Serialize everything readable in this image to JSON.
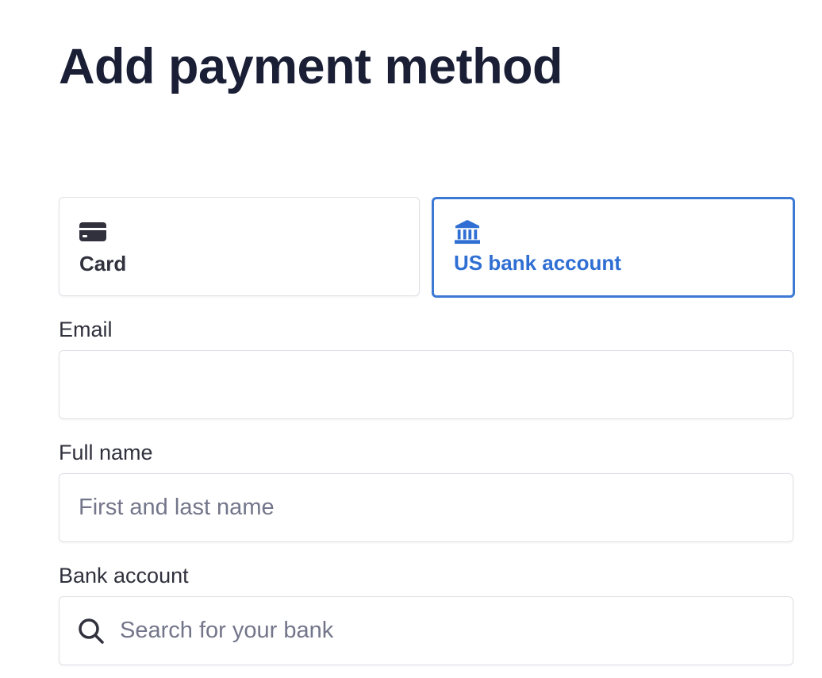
{
  "page": {
    "title": "Add payment method"
  },
  "tabs": [
    {
      "label": "Card",
      "icon": "card-icon",
      "selected": false
    },
    {
      "label": "US bank account",
      "icon": "bank-icon",
      "selected": true
    }
  ],
  "form": {
    "email": {
      "label": "Email",
      "value": "",
      "placeholder": ""
    },
    "full_name": {
      "label": "Full name",
      "value": "",
      "placeholder": "First and last name"
    },
    "bank_account": {
      "label": "Bank account",
      "value": "",
      "placeholder": "Search for your bank",
      "icon": "search-icon"
    }
  },
  "colors": {
    "title": "#1a1f36",
    "accent": "#3b79d5",
    "text": "#30313d",
    "placeholder": "#73768a",
    "border": "#dfe1e6"
  }
}
